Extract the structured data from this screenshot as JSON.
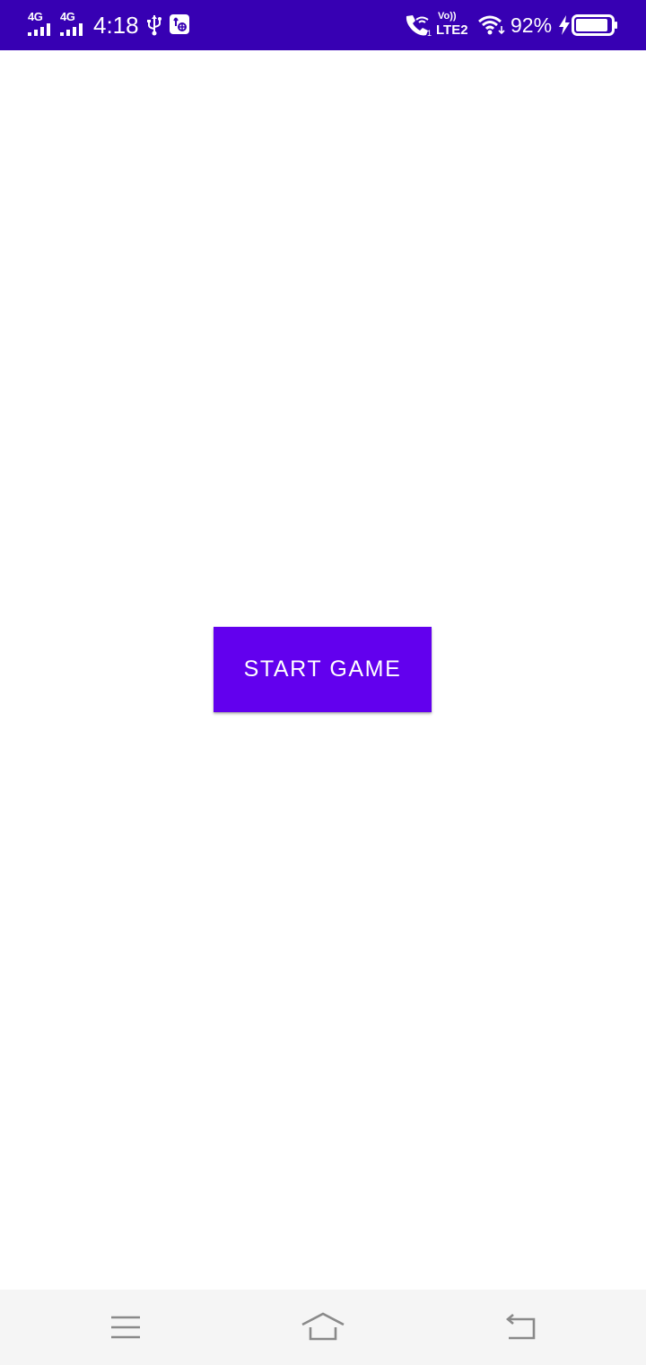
{
  "status_bar": {
    "background": "#3700B3",
    "signal_1_label": "4G",
    "signal_2_label": "4G",
    "time": "4:18",
    "volte_top": "Vo))",
    "volte_bottom": "LTE2",
    "battery_percent": "92%",
    "battery_level": 0.92,
    "icons": [
      "signal-4g-icon",
      "signal-4g-icon",
      "usb-icon",
      "usb-debugging-icon",
      "wifi-calling-icon",
      "volte-icon",
      "wifi-icon",
      "charging-bolt-icon",
      "battery-icon"
    ]
  },
  "main": {
    "start_button_label": "START GAME",
    "button_color": "#6200EE"
  },
  "nav_bar": {
    "background": "#f5f5f5",
    "icons": [
      "menu-icon",
      "home-icon",
      "back-icon"
    ]
  }
}
